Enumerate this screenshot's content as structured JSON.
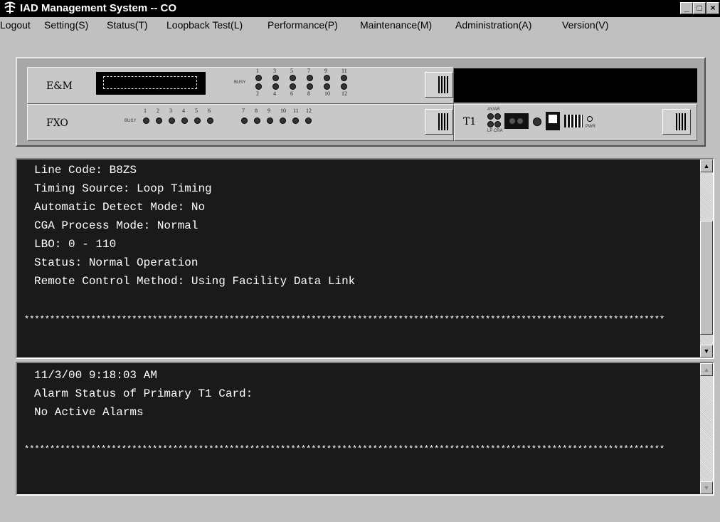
{
  "window": {
    "title": "IAD Management System -- CO",
    "controls": {
      "minimize": "_",
      "maximize": "□",
      "close": "×"
    }
  },
  "menu": {
    "items": [
      {
        "label": "Logout"
      },
      {
        "label": "Setting(S)"
      },
      {
        "label": "Status(T)"
      },
      {
        "label": "Loopback Test(L)"
      },
      {
        "label": "Performance(P)"
      },
      {
        "label": "Maintenance(M)"
      },
      {
        "label": "Administration(A)"
      },
      {
        "label": "Version(V)"
      }
    ]
  },
  "chassis": {
    "em_card": {
      "label": "E&M",
      "busy_label": "BUSY",
      "top_numbers": [
        "1",
        "3",
        "5",
        "7",
        "9",
        "11"
      ],
      "bottom_numbers": [
        "2",
        "4",
        "6",
        "8",
        "10",
        "12"
      ]
    },
    "fxo_card": {
      "label": "FXO",
      "busy_label": "BUSY",
      "numbers": [
        "1",
        "2",
        "3",
        "4",
        "5",
        "6",
        "7",
        "8",
        "9",
        "10",
        "11",
        "12"
      ]
    },
    "t1_card": {
      "label": "T1",
      "alarm_label": "AY/AR",
      "lp_label": "LP CRA",
      "pwr_label": "PWR"
    }
  },
  "top_pane": {
    "lines": [
      "Line Code: B8ZS",
      "Timing Source: Loop Timing",
      "Automatic Detect Mode: No",
      "CGA Process Mode: Normal",
      "LBO: 0 - 110",
      "Status: Normal Operation",
      "Remote Control Method: Using Facility Data Link"
    ],
    "separator": "*****************************************************************************************************************************"
  },
  "bottom_pane": {
    "lines": [
      "11/3/00 9:18:03 AM",
      "Alarm Status of Primary T1 Card:",
      "No Active Alarms"
    ],
    "separator": "*****************************************************************************************************************************"
  },
  "scroll_icons": {
    "up": "up-arrow",
    "down": "down-arrow"
  }
}
